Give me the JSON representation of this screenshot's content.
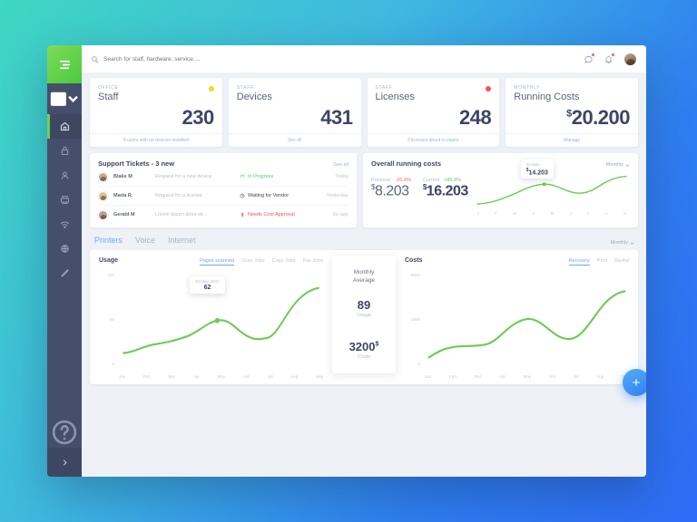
{
  "sidebar": {
    "logo_icon": "logo-bars-icon",
    "top_item": {
      "name": "device-selector-icon"
    },
    "items": [
      {
        "icon": "home-icon",
        "name": "home",
        "active": true
      },
      {
        "icon": "lock-icon",
        "name": "security",
        "active": false
      },
      {
        "icon": "user-icon",
        "name": "people",
        "active": false
      },
      {
        "icon": "printer-icon",
        "name": "printers",
        "active": false
      },
      {
        "icon": "wifi-icon",
        "name": "network",
        "active": false
      },
      {
        "icon": "globe-icon",
        "name": "internet",
        "active": false
      },
      {
        "icon": "pen-icon",
        "name": "tools",
        "active": false
      }
    ],
    "help_icon": "help-icon",
    "expand_icon": "chevron-right-icon"
  },
  "topbar": {
    "search_placeholder": "Search for staff, hardware, service....",
    "search_value": "",
    "search_icon": "search-icon",
    "messages_icon": "chat-icon",
    "notifications_icon": "bell-icon",
    "avatar": "user-avatar"
  },
  "stats": [
    {
      "label": "OFFICE",
      "title": "Staff",
      "value": "230",
      "currency": "",
      "dot_color": "#ffd426",
      "footer": "5 users with no devices installed"
    },
    {
      "label": "STAFF",
      "title": "Devices",
      "value": "431",
      "currency": "",
      "dot_color": "",
      "footer": "See all"
    },
    {
      "label": "STAFF",
      "title": "Licenses",
      "value": "248",
      "currency": "",
      "dot_color": "#ff4d5a",
      "footer": "3 licenses about to expire"
    },
    {
      "label": "MONTHLY",
      "title": "Running Costs",
      "value": "20.200",
      "currency": "$",
      "dot_color": "",
      "footer": "Manage"
    }
  ],
  "tickets": {
    "title": "Support Tickets - 3 new",
    "see_all": "See all",
    "rows": [
      {
        "name": "Blake M",
        "desc": "Request for a new device",
        "status": "In Progress",
        "status_color": "#4ccf6e",
        "status_icon": "refresh-icon",
        "time": "Today",
        "avatar_color": "#c8a88c"
      },
      {
        "name": "Maria R.",
        "desc": "Request for a license",
        "status": "Waiting for Vendor",
        "status_color": "#3d4566",
        "status_icon": "clock-icon",
        "time": "Yesterday",
        "avatar_color": "#e0c48e"
      },
      {
        "name": "Gerald M",
        "desc": "Lorem ipsum dolor sit...",
        "status": "Needs Cost Approval",
        "status_color": "#ff4d5a",
        "status_icon": "dollar-icon",
        "time": "1w ago",
        "avatar_color": "#bf9f87"
      }
    ]
  },
  "running_costs": {
    "title": "Overall running costs",
    "dropdown": "Monthly",
    "previous": {
      "name": "Previous",
      "pct": "-20.4%",
      "pct_color": "#ff8fa0",
      "currency": "$",
      "amount": "8.203"
    },
    "current": {
      "name": "Current",
      "pct": "+80.4%",
      "pct_color": "#8bd98f",
      "currency": "$",
      "amount": "16.203"
    },
    "tooltip": {
      "date": "20 May",
      "currency": "$",
      "value": "14.203"
    },
    "months": [
      "J",
      "F",
      "M",
      "A",
      "M",
      "J",
      "J",
      "A",
      "S"
    ]
  },
  "tabs": [
    {
      "label": "Printers",
      "active": true
    },
    {
      "label": "Voice",
      "active": false
    },
    {
      "label": "Internet",
      "active": false
    }
  ],
  "bottom_dropdown": "Monthly",
  "usage": {
    "title": "Usage",
    "filters": [
      {
        "label": "Pages scanned",
        "active": true
      },
      {
        "label": "Scan Jobs",
        "active": false
      },
      {
        "label": "Copy Jobs",
        "active": false
      },
      {
        "label": "Fax Jobs",
        "active": false
      }
    ],
    "tooltip": {
      "date": "20 May. 2017",
      "value": "62"
    }
  },
  "monthly_average": {
    "title": "Monthly\nAverage",
    "title_line1": "Monthly",
    "title_line2": "Average",
    "usage_value": "89",
    "usage_label": "Usage",
    "costs_value": "3200",
    "costs_currency": "$",
    "costs_label": "Costs"
  },
  "costs_chart": {
    "title": "Costs",
    "filters": [
      {
        "label": "Recovery",
        "active": true
      },
      {
        "label": "Print",
        "active": false
      },
      {
        "label": "Rental",
        "active": false
      }
    ]
  },
  "fab": {
    "icon": "plus-icon",
    "label": "+"
  },
  "chart_data": [
    {
      "type": "line",
      "id": "overall-running-costs-sparkline",
      "title": "Overall running costs",
      "x": [
        "J",
        "F",
        "M",
        "A",
        "M",
        "J",
        "J",
        "A",
        "S"
      ],
      "values": [
        4200,
        5400,
        7800,
        11000,
        14203,
        12600,
        11800,
        15400,
        18600
      ],
      "highlight_index": 4,
      "highlight_label": "20 May",
      "highlight_value": 14203,
      "ylabel": "",
      "xlabel": "",
      "grid": false,
      "legend": false,
      "line_color": "#6ecb54"
    },
    {
      "type": "line",
      "id": "usage-pages-scanned",
      "title": "Usage",
      "x": [
        "Jan",
        "Feb",
        "Mar",
        "Apr",
        "May",
        "Jun",
        "Jul",
        "Aug",
        "Sep"
      ],
      "values": [
        14,
        24,
        27,
        38,
        52,
        44,
        33,
        56,
        88
      ],
      "yticks": [
        0,
        50,
        100
      ],
      "ylim": [
        0,
        100
      ],
      "highlight_index": 4,
      "highlight_label": "20 May. 2017",
      "highlight_value": 62,
      "ylabel": "",
      "xlabel": "",
      "grid": false,
      "legend": false,
      "line_color": "#6ecb54"
    },
    {
      "type": "line",
      "id": "costs-recovery",
      "title": "Costs",
      "x": [
        "Jan",
        "Feb",
        "Mar",
        "Apr",
        "May",
        "Jun",
        "Jul",
        "Aug",
        "Sep"
      ],
      "values": [
        450,
        800,
        850,
        1900,
        2600,
        1850,
        1550,
        3400,
        4550
      ],
      "yticks": [
        0,
        2500,
        5000
      ],
      "ylim": [
        0,
        5000
      ],
      "ylabel": "",
      "xlabel": "",
      "grid": false,
      "legend": false,
      "line_color": "#6ecb54"
    }
  ]
}
